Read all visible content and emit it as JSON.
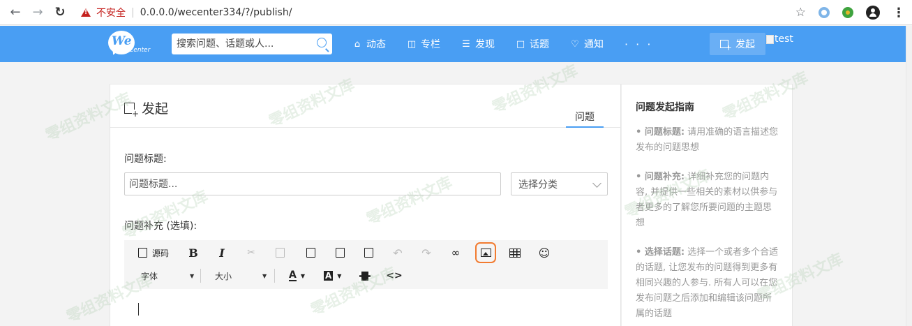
{
  "browser": {
    "security_label": "不安全",
    "url": "0.0.0.0/wecenter334/?/publish/"
  },
  "header": {
    "logo_we": "We",
    "logo_center": "Center",
    "search_placeholder": "搜索问题、话题或人...",
    "nav": [
      {
        "label": "动态",
        "icon": "home-icon"
      },
      {
        "label": "专栏",
        "icon": "column-icon"
      },
      {
        "label": "发现",
        "icon": "list-icon"
      },
      {
        "label": "话题",
        "icon": "topic-icon"
      },
      {
        "label": "通知",
        "icon": "bell-icon"
      }
    ],
    "more": "· · ·",
    "publish_label": "发起",
    "avatar_alt": "test"
  },
  "main": {
    "title": "发起",
    "tab": "问题",
    "question_title_label": "问题标题:",
    "question_title_placeholder": "问题标题...",
    "category_label": "选择分类",
    "detail_label": "问题补充 (选填):",
    "toolbar": {
      "source_label": "源码",
      "bold": "B",
      "italic": "I",
      "font_label": "字体",
      "size_label": "大小",
      "font_color": "A",
      "bg_color": "A",
      "code_label": "<>"
    }
  },
  "sidebar": {
    "title": "问题发起指南",
    "guides": [
      {
        "key": "• 问题标题:",
        "text": " 请用准确的语言描述您发布的问题思想"
      },
      {
        "key": "• 问题补充:",
        "text": " 详细补充您的问题内容, 并提供一些相关的素材以供参与者更多的了解您所要问题的主题思想"
      },
      {
        "key": "• 选择话题:",
        "text": " 选择一个或者多个合适的话题, 让您发布的问题得到更多有相同兴趣的人参与. 所有人可以在您发布问题之后添加和编辑该问题所属的话题"
      }
    ]
  },
  "watermark": "零组资料文库",
  "colors": {
    "brand": "#499ef3",
    "highlight": "#f27b30",
    "insecure": "#c5221f"
  }
}
